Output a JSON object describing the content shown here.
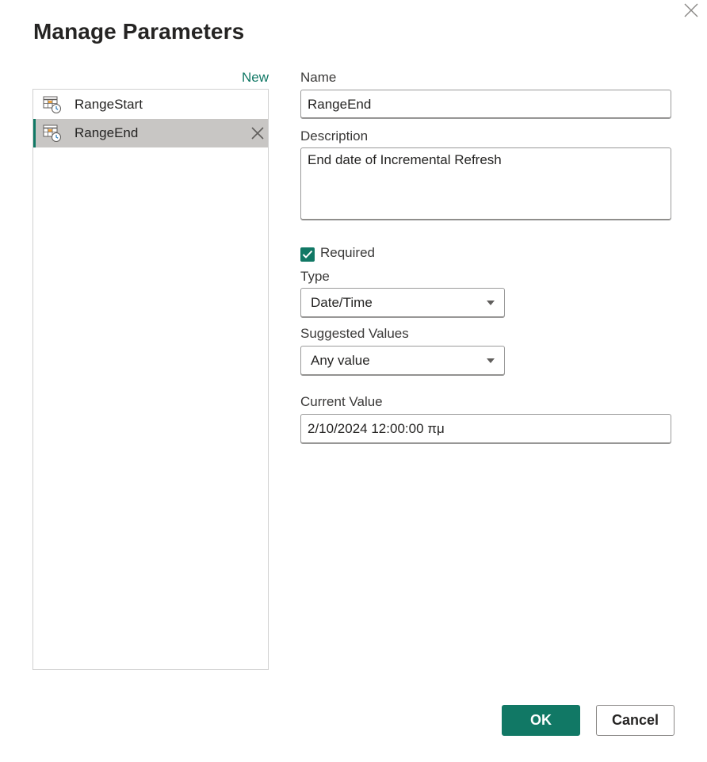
{
  "dialog": {
    "title": "Manage Parameters",
    "close_icon": "close-icon"
  },
  "sidebar": {
    "new_label": "New",
    "items": [
      {
        "label": "RangeStart",
        "icon": "datetime-parameter-icon",
        "selected": false
      },
      {
        "label": "RangeEnd",
        "icon": "datetime-parameter-icon",
        "selected": true,
        "delete_icon": "delete-x-icon"
      }
    ]
  },
  "form": {
    "name_label": "Name",
    "name_value": "RangeEnd",
    "description_label": "Description",
    "description_value": "End date of Incremental Refresh",
    "required_label": "Required",
    "required_checked": true,
    "type_label": "Type",
    "type_value": "Date/Time",
    "suggested_label": "Suggested Values",
    "suggested_value": "Any value",
    "current_value_label": "Current Value",
    "current_value": "2/10/2024 12:00:00 πμ"
  },
  "footer": {
    "ok_label": "OK",
    "cancel_label": "Cancel"
  },
  "colors": {
    "accent": "#117865",
    "selected_row": "#c8c6c4",
    "border": "#9a9a9a",
    "text": "#252423"
  }
}
